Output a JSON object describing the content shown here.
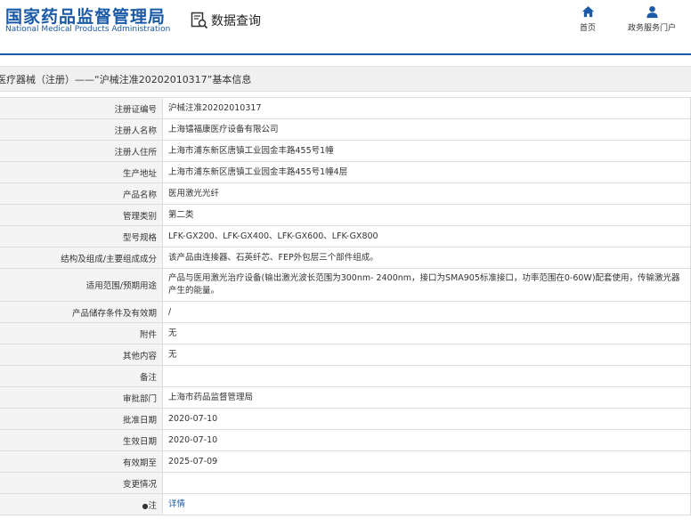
{
  "header": {
    "org_cn": "国家药品监督管理局",
    "org_en": "National Medical Products Administration",
    "search_label": "数据查询",
    "nav": [
      {
        "label": "首页",
        "icon": "home-icon"
      },
      {
        "label": "政务服务门户",
        "icon": "user-icon"
      }
    ],
    "brand_color": "#1a5aa6"
  },
  "page": {
    "title": "医疗器械（注册）——“沪械注准20202010317”基本信息"
  },
  "rows": [
    {
      "label": "注册证编号",
      "value": "沪械注准20202010317"
    },
    {
      "label": "注册人名称",
      "value": "上海镭福康医疗设备有限公司"
    },
    {
      "label": "注册人住所",
      "value": "上海市浦东新区唐镇工业园金丰路455号1幢"
    },
    {
      "label": "生产地址",
      "value": "上海市浦东新区唐镇工业园金丰路455号1幢4层"
    },
    {
      "label": "产品名称",
      "value": "医用激光光纤"
    },
    {
      "label": "管理类别",
      "value": "第二类"
    },
    {
      "label": "型号规格",
      "value": "LFK-GX200、LFK-GX400、LFK-GX600、LFK-GX800"
    },
    {
      "label": "结构及组成/主要组成成分",
      "value": "该产品由连接器、石英纤芯、FEP外包层三个部件组成。"
    },
    {
      "label": "适用范围/预期用途",
      "value": "产品与医用激光治疗设备(输出激光波长范围为300nm- 2400nm，接口为SMA905标准接口，功率范围在0-60W)配套使用，传输激光器产生的能量。"
    },
    {
      "label": "产品储存条件及有效期",
      "value": "/"
    },
    {
      "label": "附件",
      "value": "无"
    },
    {
      "label": "其他内容",
      "value": "无"
    },
    {
      "label": "备注",
      "value": ""
    },
    {
      "label": "审批部门",
      "value": "上海市药品监督管理局"
    },
    {
      "label": "批准日期",
      "value": "2020-07-10"
    },
    {
      "label": "生效日期",
      "value": "2020-07-10"
    },
    {
      "label": "有效期至",
      "value": "2025-07-09"
    },
    {
      "label": "变更情况",
      "value": ""
    }
  ],
  "memo": {
    "bullet": "●",
    "label": "注",
    "link_text": "详情"
  }
}
